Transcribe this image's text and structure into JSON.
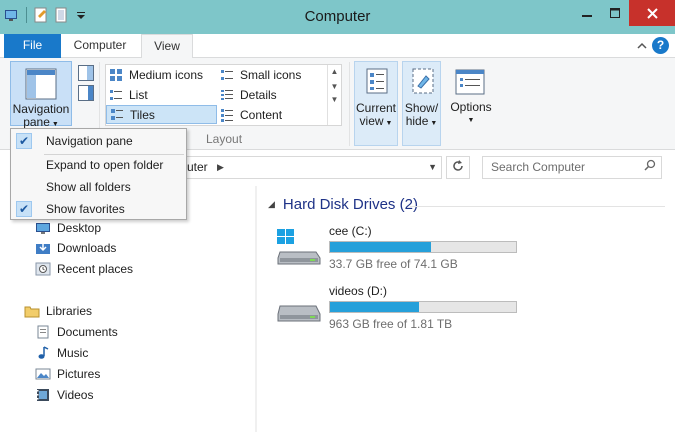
{
  "window": {
    "title": "Computer"
  },
  "tabs": {
    "file": "File",
    "computer": "Computer",
    "view": "View"
  },
  "ribbon": {
    "navigation_pane": {
      "line1": "Navigation",
      "line2": "pane"
    },
    "layout": {
      "medium_icons": "Medium icons",
      "small_icons": "Small icons",
      "list": "List",
      "details": "Details",
      "tiles": "Tiles",
      "content": "Content",
      "group_label": "Layout",
      "selected": "Tiles"
    },
    "current_view": {
      "line1": "Current",
      "line2": "view"
    },
    "show_hide": {
      "line1": "Show/",
      "line2": "hide"
    },
    "options": "Options"
  },
  "address": {
    "path": "uter",
    "search_placeholder": "Search Computer"
  },
  "nav_menu": {
    "items": [
      {
        "label": "Navigation pane",
        "checked": true
      },
      {
        "label": "Expand to open folder",
        "checked": false
      },
      {
        "label": "Show all folders",
        "checked": false
      },
      {
        "label": "Show favorites",
        "checked": true
      }
    ]
  },
  "nav_pane": {
    "favorites": [
      "Desktop",
      "Downloads",
      "Recent places"
    ],
    "libraries_label": "Libraries",
    "libraries": [
      "Documents",
      "Music",
      "Pictures",
      "Videos"
    ]
  },
  "content": {
    "group_header": "Hard Disk Drives (2)",
    "drives": [
      {
        "name": "cee (C:)",
        "free_text": "33.7 GB free of 74.1 GB",
        "used_fraction": 0.545
      },
      {
        "name": "videos (D:)",
        "free_text": "963 GB free of 1.81 TB",
        "used_fraction": 0.48
      }
    ]
  },
  "colors": {
    "titlebar": "#7ec6c9",
    "file_tab": "#1979ca",
    "close": "#c7312b",
    "bar_fill": "#26a0da"
  }
}
